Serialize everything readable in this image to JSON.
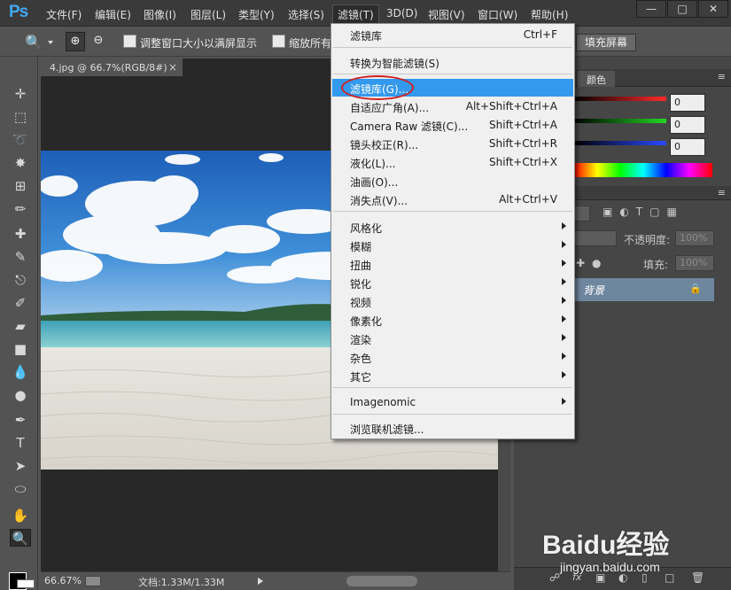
{
  "app": {
    "logo": "Ps",
    "menus": [
      "文件(F)",
      "编辑(E)",
      "图像(I)",
      "图层(L)",
      "类型(Y)",
      "选择(S)",
      "滤镜(T)",
      "3D(D)",
      "视图(V)",
      "窗口(W)",
      "帮助(H)"
    ],
    "active_menu": "滤镜(T)",
    "accent_color": "#41a9f5"
  },
  "options_bar": {
    "resize_windows_label": "调整窗口大小以满屏显示",
    "zoom_all_label": "缩放所有",
    "fill_screen_label": "填充屏幕"
  },
  "document": {
    "tab_title": "4.jpg @ 66.7%(RGB/8#)",
    "zoom": "66.67%",
    "doc_info": "文档:1.33M/1.33M"
  },
  "filter_menu": {
    "groups": [
      [
        {
          "label": "滤镜库",
          "shortcut": "Ctrl+F"
        }
      ],
      [
        {
          "label": "转换为智能滤镜(S)",
          "shortcut": ""
        }
      ],
      [
        {
          "label": "滤镜库(G)...",
          "shortcut": "",
          "highlighted": true
        },
        {
          "label": "自适应广角(A)...",
          "shortcut": "Alt+Shift+Ctrl+A"
        },
        {
          "label": "Camera Raw 滤镜(C)...",
          "shortcut": "Shift+Ctrl+A"
        },
        {
          "label": "镜头校正(R)...",
          "shortcut": "Shift+Ctrl+R"
        },
        {
          "label": "液化(L)...",
          "shortcut": "Shift+Ctrl+X"
        },
        {
          "label": "油画(O)...",
          "shortcut": ""
        },
        {
          "label": "消失点(V)...",
          "shortcut": "Alt+Ctrl+V"
        }
      ],
      [
        {
          "label": "风格化",
          "submenu": true
        },
        {
          "label": "模糊",
          "submenu": true
        },
        {
          "label": "扭曲",
          "submenu": true
        },
        {
          "label": "锐化",
          "submenu": true
        },
        {
          "label": "视频",
          "submenu": true
        },
        {
          "label": "像素化",
          "submenu": true
        },
        {
          "label": "渲染",
          "submenu": true
        },
        {
          "label": "杂色",
          "submenu": true
        },
        {
          "label": "其它",
          "submenu": true
        }
      ],
      [
        {
          "label": "Imagenomic",
          "submenu": true
        }
      ],
      [
        {
          "label": "浏览联机滤镜...",
          "shortcut": ""
        }
      ]
    ],
    "highlight_color": "#3399ee",
    "annotation_color": "#d02020"
  },
  "color_panel": {
    "tab_label": "颜色",
    "r": "0",
    "g": "0",
    "b": "0"
  },
  "layers_panel": {
    "opacity_label": "不透明度:",
    "opacity_value": "100%",
    "fill_label": "填充:",
    "fill_value": "100%",
    "layer_name": "背景"
  },
  "watermark": {
    "brand": "Baidu经验",
    "url": "jingyan.baidu.com"
  }
}
